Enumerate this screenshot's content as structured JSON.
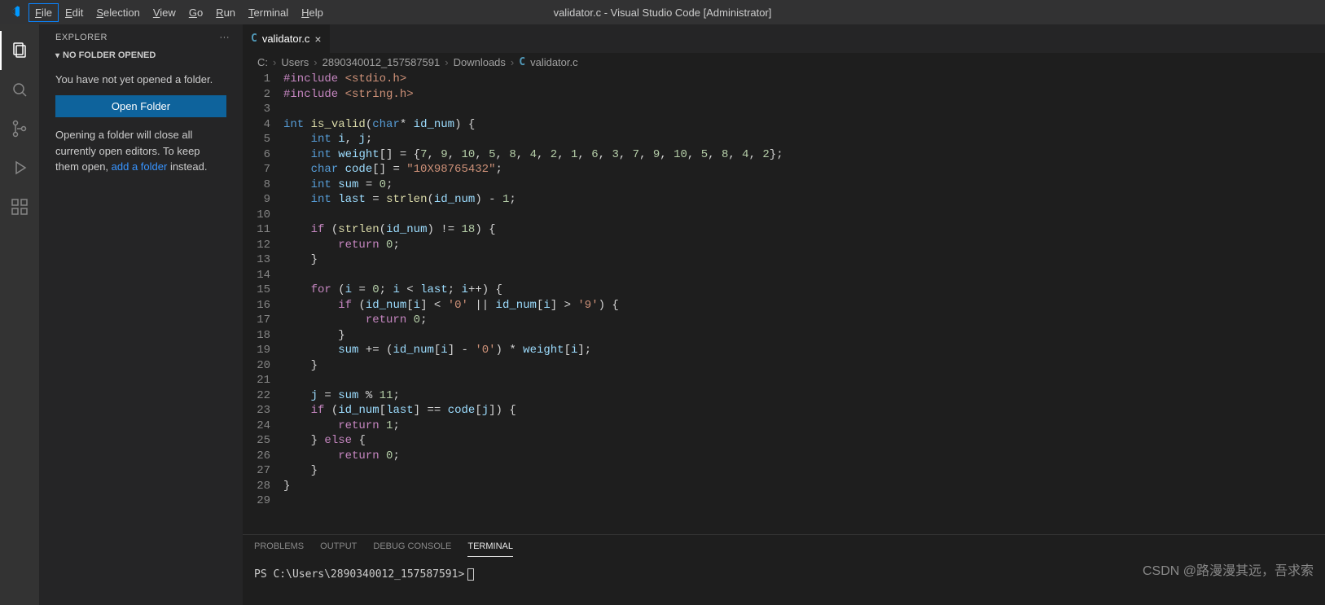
{
  "titlebar": {
    "title": "validator.c - Visual Studio Code [Administrator]",
    "menus": [
      "File",
      "Edit",
      "Selection",
      "View",
      "Go",
      "Run",
      "Terminal",
      "Help"
    ]
  },
  "activitybar": {
    "items": [
      "explorer",
      "search",
      "scm",
      "debug",
      "extensions"
    ]
  },
  "sidebar": {
    "title": "EXPLORER",
    "section": "NO FOLDER OPENED",
    "no_folder_msg": "You have not yet opened a folder.",
    "open_button": "Open Folder",
    "note_pre": "Opening a folder will close all currently open editors. To keep them open, ",
    "note_link": "add a folder",
    "note_post": " instead."
  },
  "tab": {
    "filename": "validator.c",
    "lang_icon": "C"
  },
  "breadcrumbs": [
    "C:",
    "Users",
    "2890340012_157587591",
    "Downloads",
    "validator.c"
  ],
  "code": {
    "lines": [
      [
        {
          "c": "tk-dir",
          "t": "#include"
        },
        {
          "c": "",
          "t": " "
        },
        {
          "c": "tk-inc",
          "t": "<stdio.h>"
        }
      ],
      [
        {
          "c": "tk-dir",
          "t": "#include"
        },
        {
          "c": "",
          "t": " "
        },
        {
          "c": "tk-inc",
          "t": "<string.h>"
        }
      ],
      [],
      [
        {
          "c": "tk-kw",
          "t": "int"
        },
        {
          "c": "",
          "t": " "
        },
        {
          "c": "tk-fn",
          "t": "is_valid"
        },
        {
          "c": "tk-pun",
          "t": "("
        },
        {
          "c": "tk-kw",
          "t": "char"
        },
        {
          "c": "tk-op",
          "t": "*"
        },
        {
          "c": "",
          "t": " "
        },
        {
          "c": "tk-id",
          "t": "id_num"
        },
        {
          "c": "tk-pun",
          "t": ") {"
        }
      ],
      [
        {
          "c": "",
          "t": "    "
        },
        {
          "c": "tk-kw",
          "t": "int"
        },
        {
          "c": "",
          "t": " "
        },
        {
          "c": "tk-id",
          "t": "i"
        },
        {
          "c": "tk-pun",
          "t": ", "
        },
        {
          "c": "tk-id",
          "t": "j"
        },
        {
          "c": "tk-pun",
          "t": ";"
        }
      ],
      [
        {
          "c": "",
          "t": "    "
        },
        {
          "c": "tk-kw",
          "t": "int"
        },
        {
          "c": "",
          "t": " "
        },
        {
          "c": "tk-id",
          "t": "weight"
        },
        {
          "c": "tk-pun",
          "t": "[] = {"
        },
        {
          "c": "tk-num",
          "t": "7"
        },
        {
          "c": "tk-pun",
          "t": ", "
        },
        {
          "c": "tk-num",
          "t": "9"
        },
        {
          "c": "tk-pun",
          "t": ", "
        },
        {
          "c": "tk-num",
          "t": "10"
        },
        {
          "c": "tk-pun",
          "t": ", "
        },
        {
          "c": "tk-num",
          "t": "5"
        },
        {
          "c": "tk-pun",
          "t": ", "
        },
        {
          "c": "tk-num",
          "t": "8"
        },
        {
          "c": "tk-pun",
          "t": ", "
        },
        {
          "c": "tk-num",
          "t": "4"
        },
        {
          "c": "tk-pun",
          "t": ", "
        },
        {
          "c": "tk-num",
          "t": "2"
        },
        {
          "c": "tk-pun",
          "t": ", "
        },
        {
          "c": "tk-num",
          "t": "1"
        },
        {
          "c": "tk-pun",
          "t": ", "
        },
        {
          "c": "tk-num",
          "t": "6"
        },
        {
          "c": "tk-pun",
          "t": ", "
        },
        {
          "c": "tk-num",
          "t": "3"
        },
        {
          "c": "tk-pun",
          "t": ", "
        },
        {
          "c": "tk-num",
          "t": "7"
        },
        {
          "c": "tk-pun",
          "t": ", "
        },
        {
          "c": "tk-num",
          "t": "9"
        },
        {
          "c": "tk-pun",
          "t": ", "
        },
        {
          "c": "tk-num",
          "t": "10"
        },
        {
          "c": "tk-pun",
          "t": ", "
        },
        {
          "c": "tk-num",
          "t": "5"
        },
        {
          "c": "tk-pun",
          "t": ", "
        },
        {
          "c": "tk-num",
          "t": "8"
        },
        {
          "c": "tk-pun",
          "t": ", "
        },
        {
          "c": "tk-num",
          "t": "4"
        },
        {
          "c": "tk-pun",
          "t": ", "
        },
        {
          "c": "tk-num",
          "t": "2"
        },
        {
          "c": "tk-pun",
          "t": "};"
        }
      ],
      [
        {
          "c": "",
          "t": "    "
        },
        {
          "c": "tk-kw",
          "t": "char"
        },
        {
          "c": "",
          "t": " "
        },
        {
          "c": "tk-id",
          "t": "code"
        },
        {
          "c": "tk-pun",
          "t": "[] = "
        },
        {
          "c": "tk-str",
          "t": "\"10X98765432\""
        },
        {
          "c": "tk-pun",
          "t": ";"
        }
      ],
      [
        {
          "c": "",
          "t": "    "
        },
        {
          "c": "tk-kw",
          "t": "int"
        },
        {
          "c": "",
          "t": " "
        },
        {
          "c": "tk-id",
          "t": "sum"
        },
        {
          "c": "",
          "t": " "
        },
        {
          "c": "tk-op",
          "t": "="
        },
        {
          "c": "",
          "t": " "
        },
        {
          "c": "tk-num",
          "t": "0"
        },
        {
          "c": "tk-pun",
          "t": ";"
        }
      ],
      [
        {
          "c": "",
          "t": "    "
        },
        {
          "c": "tk-kw",
          "t": "int"
        },
        {
          "c": "",
          "t": " "
        },
        {
          "c": "tk-id",
          "t": "last"
        },
        {
          "c": "",
          "t": " "
        },
        {
          "c": "tk-op",
          "t": "="
        },
        {
          "c": "",
          "t": " "
        },
        {
          "c": "tk-fn",
          "t": "strlen"
        },
        {
          "c": "tk-pun",
          "t": "("
        },
        {
          "c": "tk-id",
          "t": "id_num"
        },
        {
          "c": "tk-pun",
          "t": ") "
        },
        {
          "c": "tk-op",
          "t": "-"
        },
        {
          "c": "",
          "t": " "
        },
        {
          "c": "tk-num",
          "t": "1"
        },
        {
          "c": "tk-pun",
          "t": ";"
        }
      ],
      [],
      [
        {
          "c": "",
          "t": "    "
        },
        {
          "c": "tk-ctl",
          "t": "if"
        },
        {
          "c": "",
          "t": " "
        },
        {
          "c": "tk-pun",
          "t": "("
        },
        {
          "c": "tk-fn",
          "t": "strlen"
        },
        {
          "c": "tk-pun",
          "t": "("
        },
        {
          "c": "tk-id",
          "t": "id_num"
        },
        {
          "c": "tk-pun",
          "t": ") "
        },
        {
          "c": "tk-op",
          "t": "!="
        },
        {
          "c": "",
          "t": " "
        },
        {
          "c": "tk-num",
          "t": "18"
        },
        {
          "c": "tk-pun",
          "t": ") {"
        }
      ],
      [
        {
          "c": "",
          "t": "        "
        },
        {
          "c": "tk-ctl",
          "t": "return"
        },
        {
          "c": "",
          "t": " "
        },
        {
          "c": "tk-num",
          "t": "0"
        },
        {
          "c": "tk-pun",
          "t": ";"
        }
      ],
      [
        {
          "c": "",
          "t": "    "
        },
        {
          "c": "tk-pun",
          "t": "}"
        }
      ],
      [],
      [
        {
          "c": "",
          "t": "    "
        },
        {
          "c": "tk-ctl",
          "t": "for"
        },
        {
          "c": "",
          "t": " "
        },
        {
          "c": "tk-pun",
          "t": "("
        },
        {
          "c": "tk-id",
          "t": "i"
        },
        {
          "c": "",
          "t": " "
        },
        {
          "c": "tk-op",
          "t": "="
        },
        {
          "c": "",
          "t": " "
        },
        {
          "c": "tk-num",
          "t": "0"
        },
        {
          "c": "tk-pun",
          "t": "; "
        },
        {
          "c": "tk-id",
          "t": "i"
        },
        {
          "c": "",
          "t": " "
        },
        {
          "c": "tk-op",
          "t": "<"
        },
        {
          "c": "",
          "t": " "
        },
        {
          "c": "tk-id",
          "t": "last"
        },
        {
          "c": "tk-pun",
          "t": "; "
        },
        {
          "c": "tk-id",
          "t": "i"
        },
        {
          "c": "tk-op",
          "t": "++"
        },
        {
          "c": "tk-pun",
          "t": ") {"
        }
      ],
      [
        {
          "c": "",
          "t": "        "
        },
        {
          "c": "tk-ctl",
          "t": "if"
        },
        {
          "c": "",
          "t": " "
        },
        {
          "c": "tk-pun",
          "t": "("
        },
        {
          "c": "tk-id",
          "t": "id_num"
        },
        {
          "c": "tk-pun",
          "t": "["
        },
        {
          "c": "tk-id",
          "t": "i"
        },
        {
          "c": "tk-pun",
          "t": "] "
        },
        {
          "c": "tk-op",
          "t": "<"
        },
        {
          "c": "",
          "t": " "
        },
        {
          "c": "tk-str",
          "t": "'0'"
        },
        {
          "c": "",
          "t": " "
        },
        {
          "c": "tk-op",
          "t": "||"
        },
        {
          "c": "",
          "t": " "
        },
        {
          "c": "tk-id",
          "t": "id_num"
        },
        {
          "c": "tk-pun",
          "t": "["
        },
        {
          "c": "tk-id",
          "t": "i"
        },
        {
          "c": "tk-pun",
          "t": "] "
        },
        {
          "c": "tk-op",
          "t": ">"
        },
        {
          "c": "",
          "t": " "
        },
        {
          "c": "tk-str",
          "t": "'9'"
        },
        {
          "c": "tk-pun",
          "t": ") {"
        }
      ],
      [
        {
          "c": "",
          "t": "            "
        },
        {
          "c": "tk-ctl",
          "t": "return"
        },
        {
          "c": "",
          "t": " "
        },
        {
          "c": "tk-num",
          "t": "0"
        },
        {
          "c": "tk-pun",
          "t": ";"
        }
      ],
      [
        {
          "c": "",
          "t": "        "
        },
        {
          "c": "tk-pun",
          "t": "}"
        }
      ],
      [
        {
          "c": "",
          "t": "        "
        },
        {
          "c": "tk-id",
          "t": "sum"
        },
        {
          "c": "",
          "t": " "
        },
        {
          "c": "tk-op",
          "t": "+="
        },
        {
          "c": "",
          "t": " "
        },
        {
          "c": "tk-pun",
          "t": "("
        },
        {
          "c": "tk-id",
          "t": "id_num"
        },
        {
          "c": "tk-pun",
          "t": "["
        },
        {
          "c": "tk-id",
          "t": "i"
        },
        {
          "c": "tk-pun",
          "t": "] "
        },
        {
          "c": "tk-op",
          "t": "-"
        },
        {
          "c": "",
          "t": " "
        },
        {
          "c": "tk-str",
          "t": "'0'"
        },
        {
          "c": "tk-pun",
          "t": ") "
        },
        {
          "c": "tk-op",
          "t": "*"
        },
        {
          "c": "",
          "t": " "
        },
        {
          "c": "tk-id",
          "t": "weight"
        },
        {
          "c": "tk-pun",
          "t": "["
        },
        {
          "c": "tk-id",
          "t": "i"
        },
        {
          "c": "tk-pun",
          "t": "];"
        }
      ],
      [
        {
          "c": "",
          "t": "    "
        },
        {
          "c": "tk-pun",
          "t": "}"
        }
      ],
      [],
      [
        {
          "c": "",
          "t": "    "
        },
        {
          "c": "tk-id",
          "t": "j"
        },
        {
          "c": "",
          "t": " "
        },
        {
          "c": "tk-op",
          "t": "="
        },
        {
          "c": "",
          "t": " "
        },
        {
          "c": "tk-id",
          "t": "sum"
        },
        {
          "c": "",
          "t": " "
        },
        {
          "c": "tk-op",
          "t": "%"
        },
        {
          "c": "",
          "t": " "
        },
        {
          "c": "tk-num",
          "t": "11"
        },
        {
          "c": "tk-pun",
          "t": ";"
        }
      ],
      [
        {
          "c": "",
          "t": "    "
        },
        {
          "c": "tk-ctl",
          "t": "if"
        },
        {
          "c": "",
          "t": " "
        },
        {
          "c": "tk-pun",
          "t": "("
        },
        {
          "c": "tk-id",
          "t": "id_num"
        },
        {
          "c": "tk-pun",
          "t": "["
        },
        {
          "c": "tk-id",
          "t": "last"
        },
        {
          "c": "tk-pun",
          "t": "] "
        },
        {
          "c": "tk-op",
          "t": "=="
        },
        {
          "c": "",
          "t": " "
        },
        {
          "c": "tk-id",
          "t": "code"
        },
        {
          "c": "tk-pun",
          "t": "["
        },
        {
          "c": "tk-id",
          "t": "j"
        },
        {
          "c": "tk-pun",
          "t": "]) {"
        }
      ],
      [
        {
          "c": "",
          "t": "        "
        },
        {
          "c": "tk-ctl",
          "t": "return"
        },
        {
          "c": "",
          "t": " "
        },
        {
          "c": "tk-num",
          "t": "1"
        },
        {
          "c": "tk-pun",
          "t": ";"
        }
      ],
      [
        {
          "c": "",
          "t": "    "
        },
        {
          "c": "tk-pun",
          "t": "} "
        },
        {
          "c": "tk-ctl",
          "t": "else"
        },
        {
          "c": "",
          "t": " "
        },
        {
          "c": "tk-pun",
          "t": "{"
        }
      ],
      [
        {
          "c": "",
          "t": "        "
        },
        {
          "c": "tk-ctl",
          "t": "return"
        },
        {
          "c": "",
          "t": " "
        },
        {
          "c": "tk-num",
          "t": "0"
        },
        {
          "c": "tk-pun",
          "t": ";"
        }
      ],
      [
        {
          "c": "",
          "t": "    "
        },
        {
          "c": "tk-pun",
          "t": "}"
        }
      ],
      [
        {
          "c": "tk-pun",
          "t": "}"
        }
      ],
      []
    ]
  },
  "panel": {
    "tabs": [
      "PROBLEMS",
      "OUTPUT",
      "DEBUG CONSOLE",
      "TERMINAL"
    ],
    "active_tab": 3,
    "prompt": "PS C:\\Users\\2890340012_157587591> "
  },
  "watermark": "CSDN @路漫漫其远，吾求索"
}
